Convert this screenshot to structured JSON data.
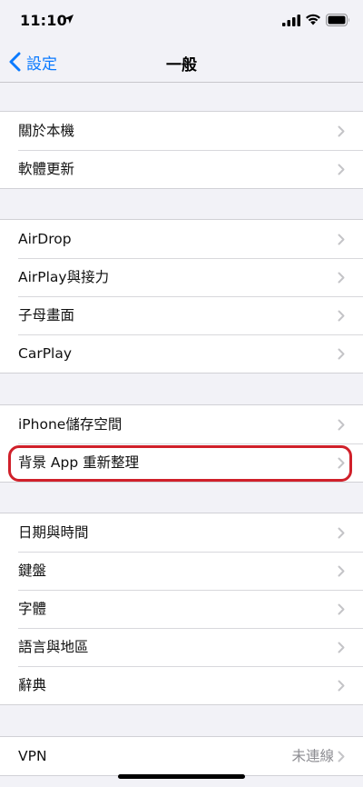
{
  "status": {
    "time": "11:10"
  },
  "nav": {
    "back_label": "設定",
    "title": "一般"
  },
  "groups": [
    {
      "rows": [
        {
          "label": "關於本機"
        },
        {
          "label": "軟體更新"
        }
      ]
    },
    {
      "rows": [
        {
          "label": "AirDrop"
        },
        {
          "label": "AirPlay與接力"
        },
        {
          "label": "子母畫面"
        },
        {
          "label": "CarPlay"
        }
      ]
    },
    {
      "rows": [
        {
          "label": "iPhone儲存空間"
        },
        {
          "label": "背景 App 重新整理"
        }
      ]
    },
    {
      "rows": [
        {
          "label": "日期與時間"
        },
        {
          "label": "鍵盤"
        },
        {
          "label": "字體"
        },
        {
          "label": "語言與地區"
        },
        {
          "label": "辭典"
        }
      ]
    },
    {
      "rows": [
        {
          "label": "VPN",
          "detail": "未連線"
        }
      ]
    }
  ],
  "icons": {
    "back": "chevron-left-icon",
    "row": "chevron-right-icon",
    "status": [
      "location-arrow-icon",
      "cellular-signal-icon",
      "wifi-icon",
      "battery-icon"
    ]
  },
  "colors": {
    "accent": "#0a7aff",
    "highlight": "#d0202a",
    "background": "#f2f2f7"
  }
}
